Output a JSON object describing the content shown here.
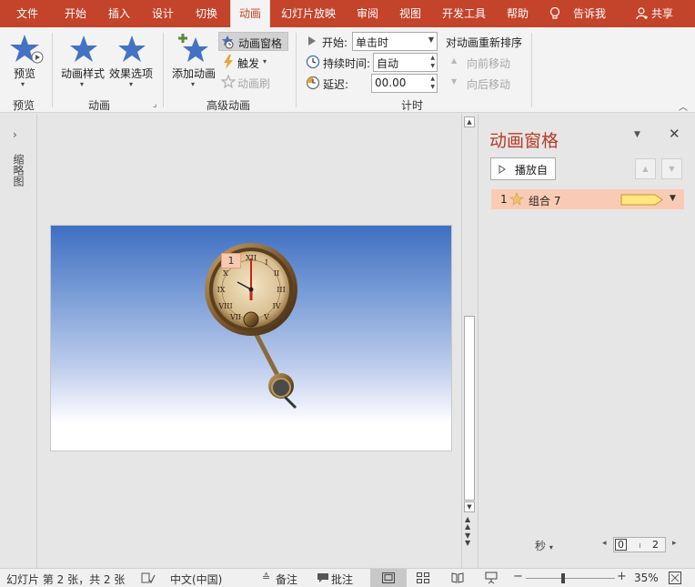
{
  "tabs": [
    {
      "label": "文件",
      "active": false
    },
    {
      "label": "开始",
      "active": false
    },
    {
      "label": "插入",
      "active": false
    },
    {
      "label": "设计",
      "active": false
    },
    {
      "label": "切换",
      "active": false
    },
    {
      "label": "动画",
      "active": true
    },
    {
      "label": "幻灯片放映",
      "active": false
    },
    {
      "label": "审阅",
      "active": false
    },
    {
      "label": "视图",
      "active": false
    },
    {
      "label": "开发工具",
      "active": false
    },
    {
      "label": "帮助",
      "active": false
    }
  ],
  "tell_me": "告诉我",
  "share": "共享",
  "ribbon": {
    "preview": {
      "button": "预览",
      "group": "预览"
    },
    "animation": {
      "styles": "动画样式",
      "effects": "效果选项",
      "group": "动画"
    },
    "advanced": {
      "add": "添加动画",
      "pane": "动画窗格",
      "trigger": "触发",
      "painter": "动画刷",
      "group": "高级动画"
    },
    "timing": {
      "start_label": "开始:",
      "start_value": "单击时",
      "duration_label": "持续时间:",
      "duration_value": "自动",
      "delay_label": "延迟:",
      "delay_value": "00.00",
      "reorder": "对动画重新排序",
      "move_earlier": "向前移动",
      "move_later": "向后移动",
      "group": "计时"
    }
  },
  "thumbnail_label": "缩略图",
  "slide": {
    "badge": "1"
  },
  "pane": {
    "title": "动画窗格",
    "play_button": "播放自",
    "items": [
      {
        "number": "1",
        "name": "组合 7"
      }
    ],
    "timeline_unit": "秒",
    "timeline_start": "0",
    "timeline_end": "2"
  },
  "status": {
    "slide_info": "幻灯片 第 2 张，共 2 张",
    "language": "中文(中国)",
    "notes": "备注",
    "comments": "批注",
    "zoom": "35%",
    "zoom_fraction": 0.42
  },
  "colors": {
    "accent": "#c4432b",
    "title": "#b83a25",
    "selected_row": "#f9cbb5",
    "bar": "#fde67f",
    "star": "#4472c4"
  }
}
